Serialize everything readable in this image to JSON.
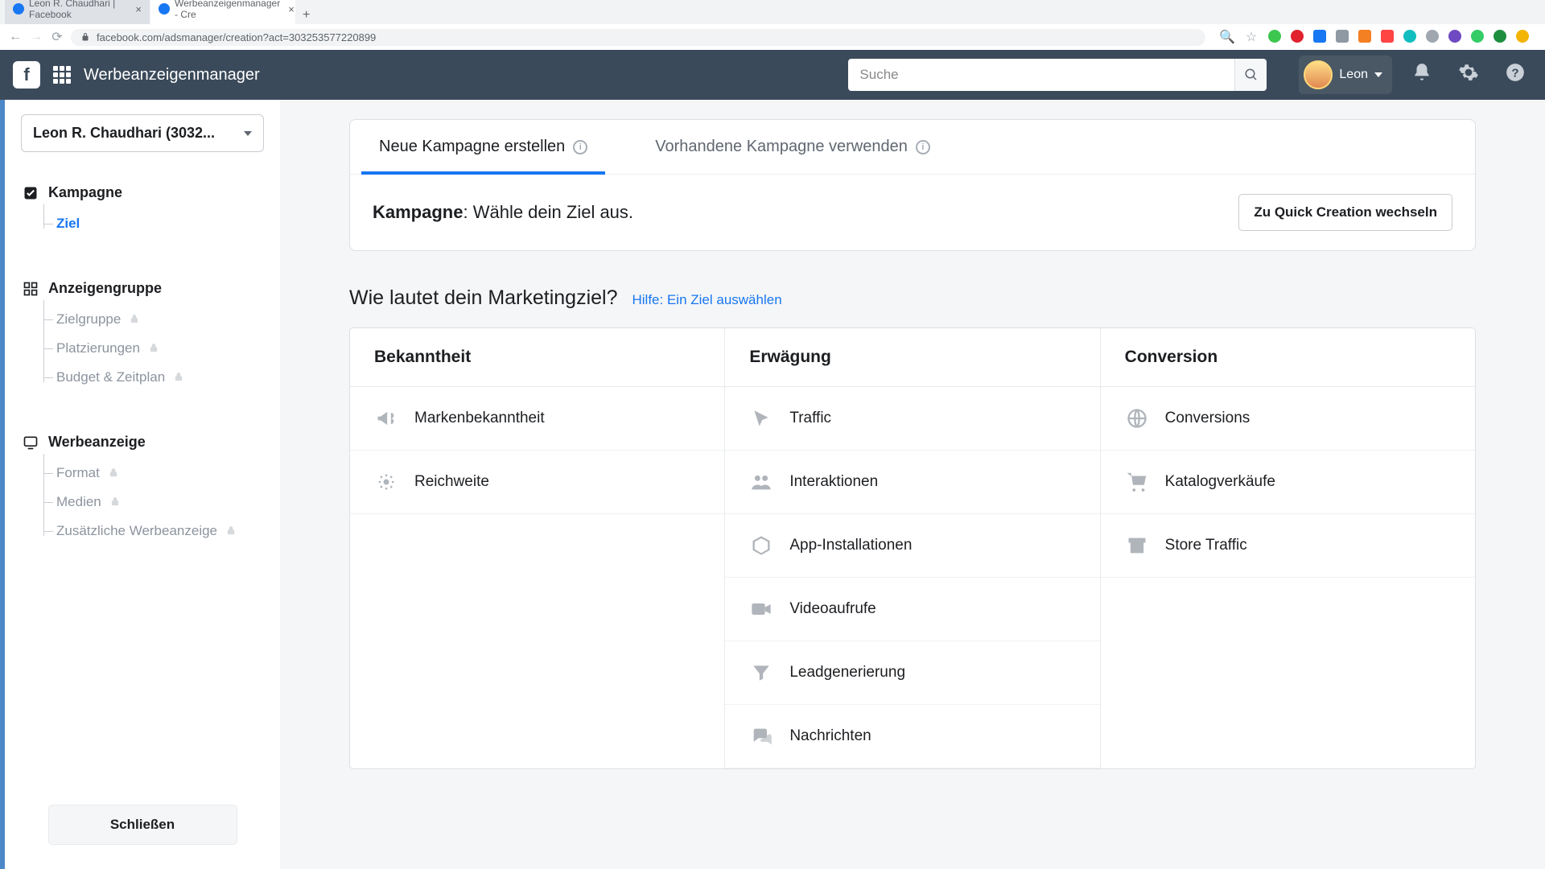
{
  "browser": {
    "tabs": [
      {
        "title": "Leon R. Chaudhari | Facebook",
        "active": false
      },
      {
        "title": "Werbeanzeigenmanager - Cre",
        "active": true
      }
    ],
    "url": "facebook.com/adsmanager/creation?act=303253577220899"
  },
  "header": {
    "app_title": "Werbeanzeigenmanager",
    "search_placeholder": "Suche",
    "user_name": "Leon"
  },
  "sidebar": {
    "account_label": "Leon R. Chaudhari (3032...",
    "sections": {
      "campaign": {
        "label": "Kampagne",
        "items": {
          "goal": "Ziel"
        }
      },
      "adset": {
        "label": "Anzeigengruppe",
        "items": {
          "audience": "Zielgruppe",
          "placements": "Platzierungen",
          "budget": "Budget & Zeitplan"
        }
      },
      "ad": {
        "label": "Werbeanzeige",
        "items": {
          "format": "Format",
          "media": "Medien",
          "additional": "Zusätzliche Werbeanzeige"
        }
      }
    },
    "close_label": "Schließen"
  },
  "main": {
    "tabs": {
      "new": "Neue Kampagne erstellen",
      "existing": "Vorhandene Kampagne verwenden"
    },
    "heading_strong": "Kampagne",
    "heading_rest": ": Wähle dein Ziel aus.",
    "quick_btn": "Zu Quick Creation wechseln",
    "question": "Wie lautet dein Marketingziel?",
    "help_link": "Hilfe: Ein Ziel auswählen",
    "columns": {
      "awareness": {
        "title": "Bekanntheit",
        "items": {
          "brand": "Markenbekanntheit",
          "reach": "Reichweite"
        }
      },
      "consideration": {
        "title": "Erwägung",
        "items": {
          "traffic": "Traffic",
          "engagement": "Interaktionen",
          "apps": "App-Installationen",
          "video": "Videoaufrufe",
          "leads": "Leadgenerierung",
          "messages": "Nachrichten"
        }
      },
      "conversion": {
        "title": "Conversion",
        "items": {
          "conversions": "Conversions",
          "catalog": "Katalogverkäufe",
          "store": "Store Traffic"
        }
      }
    }
  }
}
